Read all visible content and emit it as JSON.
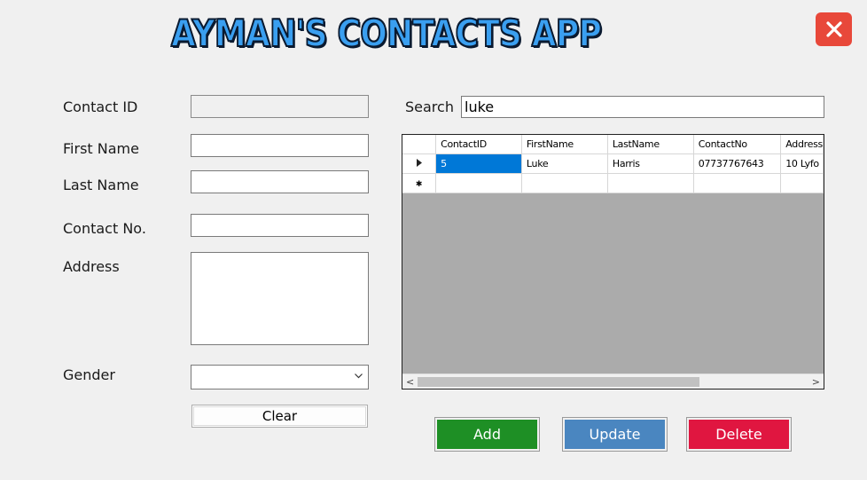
{
  "app": {
    "title": "AYMAN'S CONTACTS APP"
  },
  "form": {
    "contact_id_label": "Contact ID",
    "contact_id_value": "",
    "first_name_label": "First Name",
    "first_name_value": "",
    "last_name_label": "Last Name",
    "last_name_value": "",
    "contact_no_label": "Contact No.",
    "contact_no_value": "",
    "address_label": "Address",
    "address_value": "",
    "gender_label": "Gender",
    "gender_value": "",
    "clear_label": "Clear"
  },
  "search": {
    "label": "Search",
    "value": "luke"
  },
  "grid": {
    "columns": [
      "ContactID",
      "FirstName",
      "LastName",
      "ContactNo",
      "Address"
    ],
    "rows": [
      [
        "5",
        "Luke",
        "Harris",
        "07737767643",
        "10 Lyfo"
      ]
    ]
  },
  "actions": {
    "add_label": "Add",
    "update_label": "Update",
    "delete_label": "Delete"
  },
  "colors": {
    "add": "#1e8f25",
    "update": "#4a86c0",
    "delete": "#e01640",
    "close": "#e8483a",
    "selection": "#0078d7"
  },
  "icons": {
    "close": "close-icon",
    "current_row": "row-pointer-icon",
    "new_row": "new-row-icon",
    "dropdown": "chevron-down-icon"
  }
}
